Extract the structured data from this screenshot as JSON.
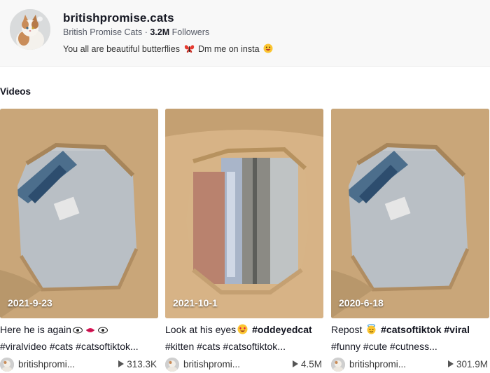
{
  "profile": {
    "username": "britishpromise.cats",
    "display_name": "British Promise Cats",
    "followers_count": "3.2M",
    "followers_label": "Followers",
    "bio_text_1": "You all are beautiful butterflies",
    "bio_text_2": "Dm me on insta"
  },
  "section_title": "Videos",
  "videos": [
    {
      "date": "2021-9-23",
      "caption_line1": "Here he is again",
      "caption_line2": "#viralvideo #cats #catsoftiktok...",
      "author": "britishpromi...",
      "views": "313.3K"
    },
    {
      "date": "2021-10-1",
      "caption_line1": "Look at his eyes",
      "caption_tag": "#oddeyedcat",
      "caption_line2": "#kitten #cats #catsoftiktok...",
      "author": "britishpromi...",
      "views": "4.5M"
    },
    {
      "date": "2020-6-18",
      "caption_line1": "Repost",
      "caption_tag": "#catsoftiktok #viral",
      "caption_line2": "#funny #cute #cutness...",
      "author": "britishpromi...",
      "views": "301.9M"
    }
  ],
  "icons": {
    "butterfly": "butterfly-emoji",
    "grin": "grin-emoji",
    "eyes": "eyes-emoji",
    "lips": "lips-emoji",
    "heart_eyes": "heart-eyes-emoji",
    "halo": "halo-emoji",
    "play": "play-icon"
  }
}
